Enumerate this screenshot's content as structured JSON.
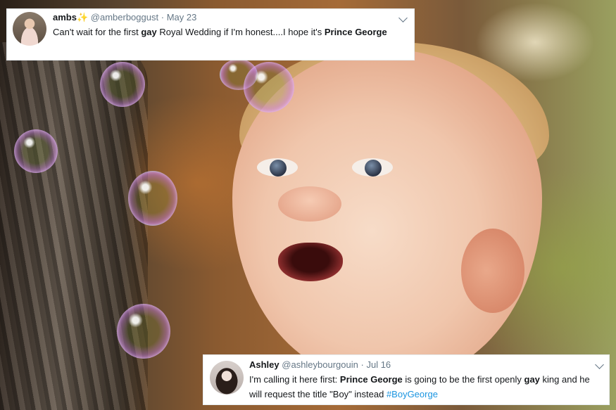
{
  "tweets": [
    {
      "name": "ambs",
      "emoji": "✨",
      "handle": "@amberboggust",
      "separator": "·",
      "date": "May 23",
      "text_parts": [
        "Can't wait for the first ",
        "gay",
        " Royal Wedding if I'm honest....I hope it's ",
        "Prince George"
      ]
    },
    {
      "name": "Ashley",
      "handle": "@ashleybourgouin",
      "separator": "·",
      "date": "Jul 16",
      "text_parts": [
        "I'm calling it here first: ",
        "Prince George",
        " is going to be the first openly ",
        "gay",
        " king and he will request the title \"Boy\" instead ",
        "#BoyGeorge"
      ]
    }
  ],
  "colors": {
    "name": "#14171a",
    "muted": "#657786",
    "hashtag": "#1b95e0",
    "card_bg": "#ffffff"
  },
  "icons": [
    "sparkles-icon",
    "chevron-down-icon",
    "avatar"
  ]
}
